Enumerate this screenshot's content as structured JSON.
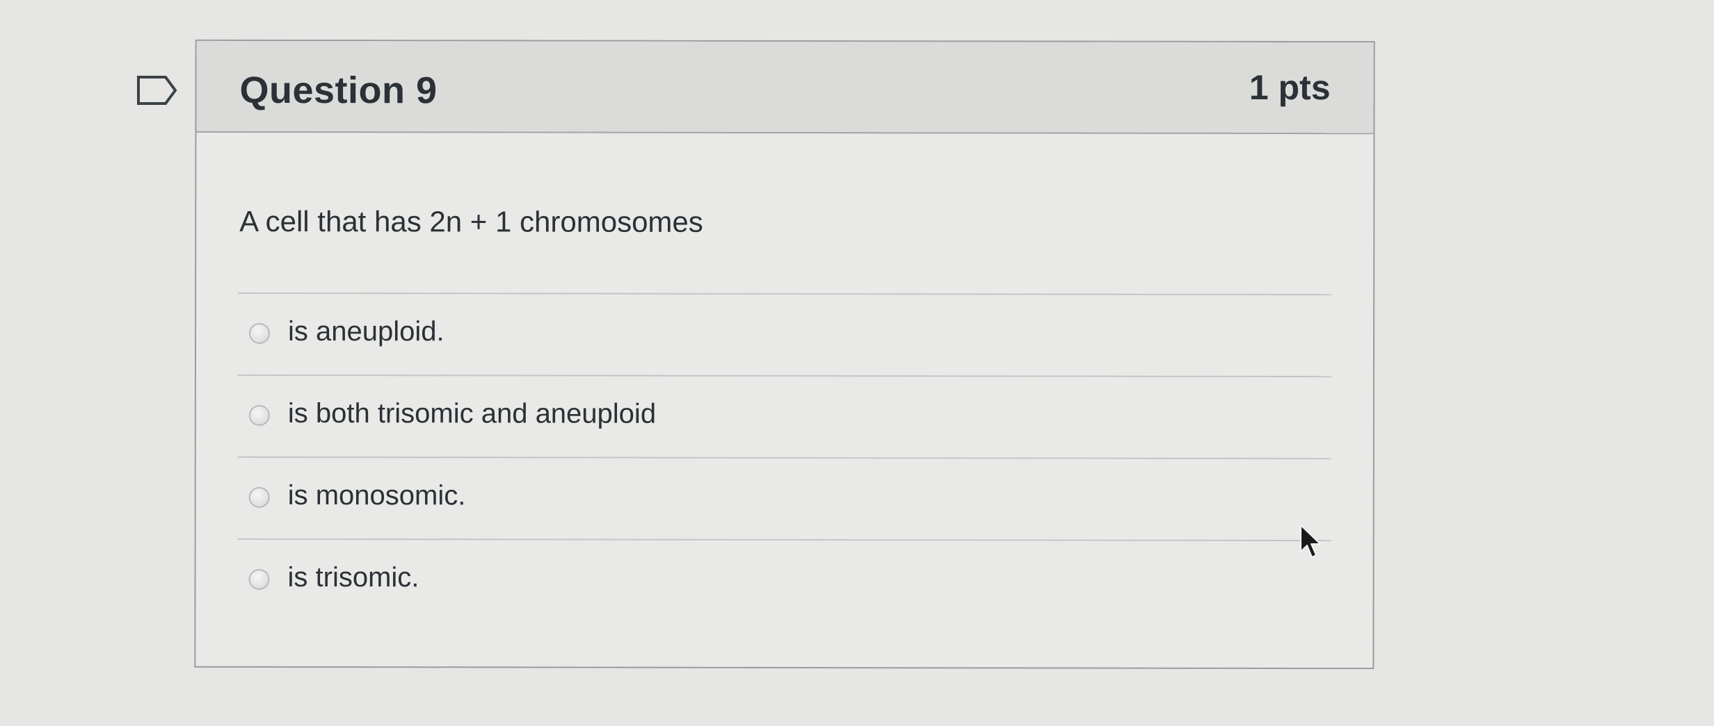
{
  "question": {
    "title": "Question 9",
    "points": "1 pts",
    "text": "A cell that has 2n + 1 chromosomes",
    "answers": [
      {
        "label": "is aneuploid.",
        "selected": false
      },
      {
        "label": "is both trisomic and aneuploid",
        "selected": false
      },
      {
        "label": "is monosomic.",
        "selected": false
      },
      {
        "label": "is trisomic.",
        "selected": false
      }
    ]
  },
  "icons": {
    "flag": "flag-icon",
    "cursor": "mouse-pointer-icon",
    "radio": "radio-button"
  }
}
